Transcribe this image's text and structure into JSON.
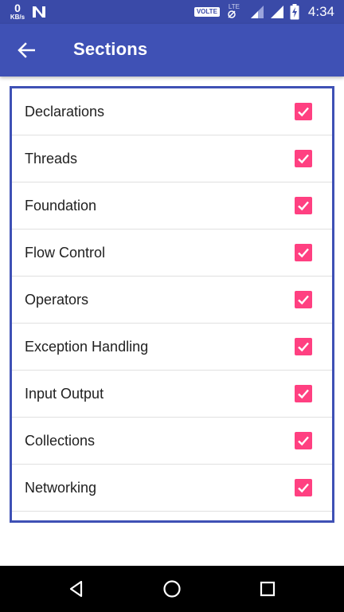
{
  "status_bar": {
    "net_speed_value": "0",
    "net_speed_unit": "KB/s",
    "volte_label": "VOLTE",
    "lte_label": "LTE",
    "time": "4:34"
  },
  "app_bar": {
    "title": "Sections",
    "back_icon": "arrow-left-icon"
  },
  "sections": [
    {
      "label": "Declarations",
      "checked": true
    },
    {
      "label": "Threads",
      "checked": true
    },
    {
      "label": "Foundation",
      "checked": true
    },
    {
      "label": "Flow Control",
      "checked": true
    },
    {
      "label": "Operators",
      "checked": true
    },
    {
      "label": "Exception Handling",
      "checked": true
    },
    {
      "label": "Input Output",
      "checked": true
    },
    {
      "label": "Collections",
      "checked": true
    },
    {
      "label": "Networking",
      "checked": true
    }
  ],
  "colors": {
    "status_bar": "#3a4aa8",
    "primary": "#3f51b5",
    "accent": "#ff4081"
  },
  "nav_bar": {
    "icons": [
      "back-triangle-icon",
      "home-circle-icon",
      "recents-square-icon"
    ]
  }
}
